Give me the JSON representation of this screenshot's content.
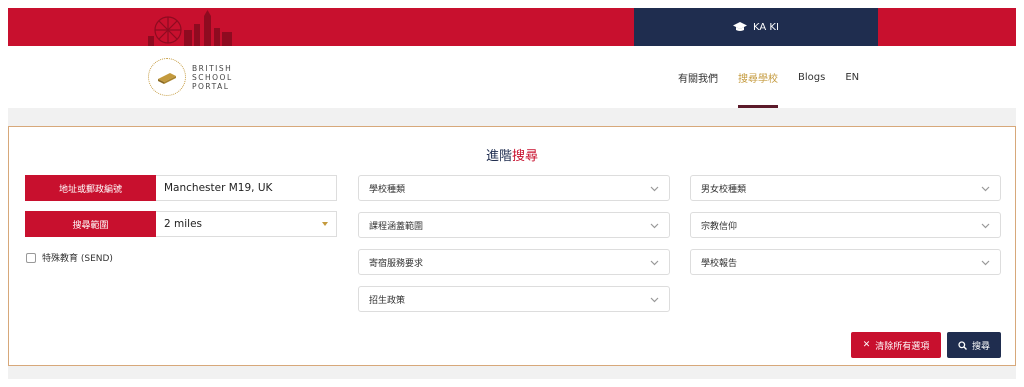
{
  "topbar": {
    "user_name": "KA KI",
    "user_icon": "graduation-cap-icon",
    "skyline": "london-skyline-graphic"
  },
  "logo": {
    "line1": "BRITISH",
    "line2": "SCHOOL",
    "line3": "PORTAL",
    "icon": "book-icon"
  },
  "nav": {
    "items": [
      {
        "label": "有關我們",
        "active": false
      },
      {
        "label": "搜尋學校",
        "active": true
      },
      {
        "label": "Blogs",
        "active": false
      },
      {
        "label": "EN",
        "active": false
      }
    ]
  },
  "search": {
    "title_prefix": "進階",
    "title_highlight": "搜尋",
    "location_label": "地址或郵政編號",
    "location_value": "Manchester M19, UK",
    "radius_label": "搜尋範圍",
    "radius_value": "2 miles",
    "send_label": "特殊教育 (SEND)",
    "send_checked": false,
    "filters_col2": [
      "學校種類",
      "課程涵蓋範圍",
      "寄宿服務要求",
      "招生政策"
    ],
    "filters_col3": [
      "男女校種類",
      "宗教信仰",
      "學校報告"
    ],
    "clear_label": "清除所有選項",
    "search_label": "搜尋"
  },
  "colors": {
    "brand_red": "#c8102e",
    "navy": "#1f2d4f",
    "gold": "#c49a3d"
  }
}
